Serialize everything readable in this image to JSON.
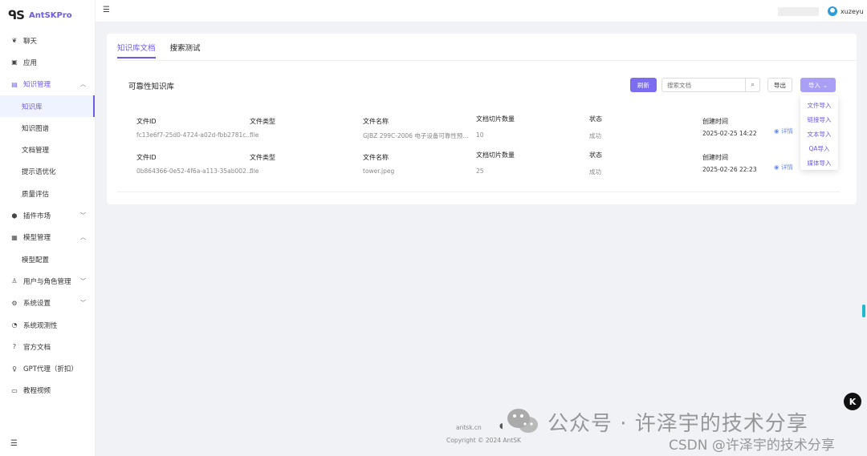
{
  "app": {
    "logo_mark": "ᑫS",
    "name": "AntSKPro"
  },
  "sidebar": {
    "items": [
      {
        "label": "聊天",
        "icon": "chat-icon",
        "glyph": "❦"
      },
      {
        "label": "应用",
        "icon": "app-icon",
        "glyph": "▣"
      },
      {
        "label": "知识管理",
        "icon": "book-icon",
        "glyph": "▤",
        "expanded": true
      },
      {
        "label": "知识库",
        "sub": true,
        "selected": true
      },
      {
        "label": "知识图谱",
        "sub": true
      },
      {
        "label": "文档管理",
        "sub": true
      },
      {
        "label": "提示语优化",
        "sub": true
      },
      {
        "label": "质量评估",
        "sub": true
      },
      {
        "label": "插件市场",
        "icon": "plugin-icon",
        "glyph": "⬢",
        "collapsed": true
      },
      {
        "label": "模型管理",
        "icon": "model-icon",
        "glyph": "▦",
        "expanded": true
      },
      {
        "label": "模型配置",
        "sub": true
      },
      {
        "label": "用户与角色管理",
        "icon": "user-icon",
        "glyph": "♙",
        "collapsed": true
      },
      {
        "label": "系统设置",
        "icon": "gear-icon",
        "glyph": "⚙",
        "collapsed": true
      },
      {
        "label": "系统观测性",
        "icon": "observe-icon",
        "glyph": "◔"
      },
      {
        "label": "官方文档",
        "icon": "question-icon",
        "glyph": "?"
      },
      {
        "label": "GPT代理（折扣）",
        "icon": "bulb-icon",
        "glyph": "♀"
      },
      {
        "label": "教程视频",
        "icon": "video-icon",
        "glyph": "▭"
      }
    ]
  },
  "header": {
    "user": "xuzeyu"
  },
  "tabs": [
    {
      "label": "知识库文档",
      "active": true
    },
    {
      "label": "搜索测试",
      "active": false
    }
  ],
  "kb": {
    "title": "可靠性知识库",
    "refresh": "刷新",
    "search_placeholder": "搜索文档",
    "export": "导出",
    "import": "导入"
  },
  "columns": {
    "id": "文件ID",
    "type": "文件类型",
    "name": "文件名称",
    "chunks": "文档切片数量",
    "status": "状态",
    "created": "创建时间",
    "detail": "详情"
  },
  "rows": [
    {
      "id": "fc13e6f7-25d0-4724-a02d-fbb2781c...",
      "type": "file",
      "name": "GJBZ 299C-2006 电子设备可靠性预...",
      "chunks": "10",
      "status": "成功",
      "created": "2025-02-25 14:22"
    },
    {
      "id": "0b864366-0e52-4f6a-a113-35ab002...",
      "type": "file",
      "name": "tower.jpeg",
      "chunks": "25",
      "status": "成功",
      "created": "2025-02-26 22:23"
    }
  ],
  "import_menu": [
    "文件导入",
    "链接导入",
    "文本导入",
    "QA导入",
    "媒体导入"
  ],
  "footer": {
    "site": "antsk.cn",
    "copyright": "Copyright © 2024 AntSK"
  },
  "watermark": {
    "main": "公众号 · 许泽宇的技术分享",
    "csdn": "CSDN @许泽宇的技术分享"
  },
  "float_button": "K"
}
